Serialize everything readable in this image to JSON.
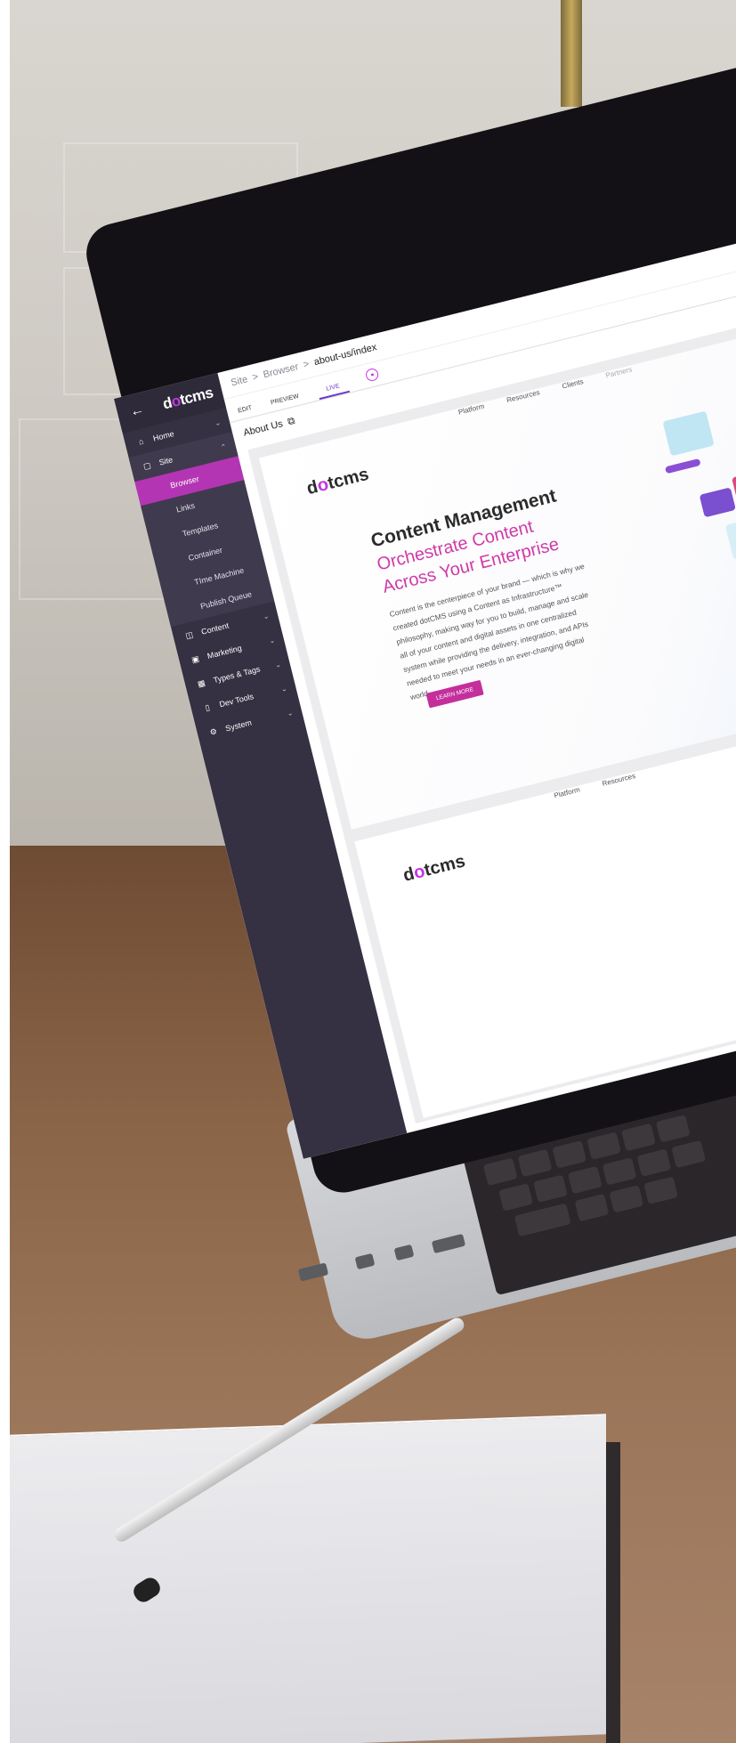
{
  "sidebar": {
    "logo_pre": "d",
    "logo_dot": "o",
    "logo_post": "tcms",
    "items": [
      {
        "label": "Home"
      },
      {
        "label": "Site"
      },
      {
        "label": "Content"
      },
      {
        "label": "Marketing"
      },
      {
        "label": "Types & Tags"
      },
      {
        "label": "Dev Tools"
      },
      {
        "label": "System"
      }
    ],
    "site_children": [
      "Browser",
      "Links",
      "Templates",
      "Container",
      "TIme Machine",
      "Publish Queue"
    ]
  },
  "breadcrumb": {
    "site": "Site",
    "sep1": ">",
    "browser": "Browser",
    "sep2": ">",
    "current": "about-us/index"
  },
  "tabs": [
    "EDIT",
    "PREVIEW",
    "LIVE"
  ],
  "page": {
    "title": "About Us"
  },
  "preview": {
    "nav": [
      "Platform",
      "Resources",
      "Clients",
      "Partners"
    ],
    "logo_pre": "d",
    "logo_dot": "o",
    "logo_post": "tcms",
    "headline": "Content Management",
    "subhead1": "Orchestrate Content",
    "subhead2": "Across Your Enterprise",
    "body": "Content is the centerpiece of your brand — which is why we created dotCMS using a Content as Infrastructure™ philosophy, making way for you to build, manage and scale all of your content and digital assets in one centralized system while providing the delivery, integration, and APIs needed to meet your needs in an ever-changing digital world.",
    "cta": "LEARN MORE"
  },
  "preview2": {
    "nav": [
      "Platform",
      "Resources"
    ]
  },
  "colors": {
    "accent": "#b435b4",
    "sidebar": "#353042",
    "headline_pink": "#d03aa6"
  }
}
